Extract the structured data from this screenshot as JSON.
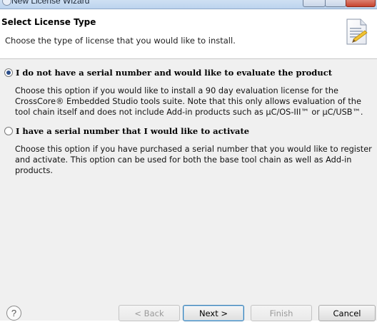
{
  "window": {
    "title": "New License Wizard"
  },
  "header": {
    "title": "Select License Type",
    "description": "Choose the type of license that you would like to install."
  },
  "options": [
    {
      "label": "I do not have a serial number and would like to evaluate the product",
      "description": "Choose this option if you would like to install a 90 day evaluation license for the CrossCore® Embedded Studio tools suite. Note that this only allows evaluation of the tool chain itself and does not include Add-in products such as µC/OS-III™ or µC/USB™.",
      "selected": true
    },
    {
      "label": "I have a serial number that I would like to activate",
      "description": "Choose this option if you have purchased a serial number that you would like to register and activate. This option can be used for both the base tool chain as well as Add-in products.",
      "selected": false
    }
  ],
  "footer": {
    "help_glyph": "?",
    "back_label": "< Back",
    "next_label": "Next >",
    "finish_label": "Finish",
    "cancel_label": "Cancel"
  },
  "icons": {
    "header_icon": "license-document-icon",
    "help_icon": "help-icon"
  },
  "colors": {
    "accent": "#3c7fb1",
    "content_bg": "#f0f0f0",
    "header_bg": "#ffffff"
  }
}
